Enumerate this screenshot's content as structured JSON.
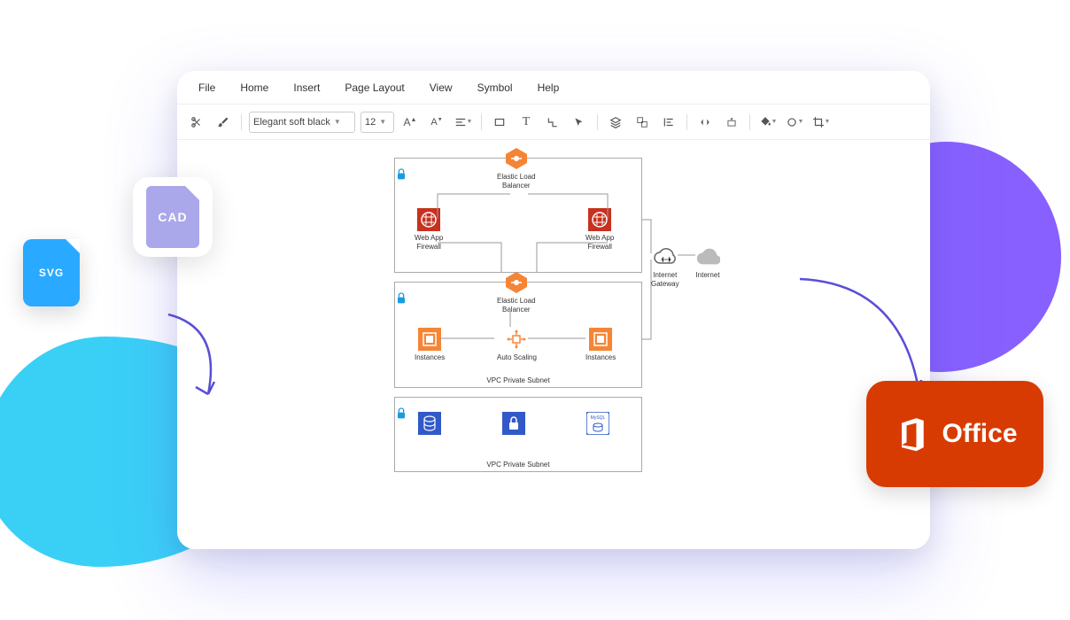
{
  "menubar": [
    "File",
    "Home",
    "Insert",
    "Page Layout",
    "View",
    "Symbol",
    "Help"
  ],
  "toolbar": {
    "font": "Elegant soft black",
    "size": "12"
  },
  "diagram": {
    "nodes": {
      "elb1": "Elastic Load\nBalancer",
      "waf1": "Web App\nFirewall",
      "waf2": "Web App\nFirewall",
      "elb2": "Elastic Load\nBalancer",
      "inst1": "Instances",
      "autoscale": "Auto Scaling",
      "inst2": "Instances",
      "igw": "Internet\nGateway",
      "internet": "Internet",
      "mysql": "MySQL"
    },
    "groups": {
      "g2": "VPC Private Subnet",
      "g3": "VPC Private Subnet"
    }
  },
  "badges": {
    "svg": "SVG",
    "cad": "CAD",
    "office": "Office"
  }
}
